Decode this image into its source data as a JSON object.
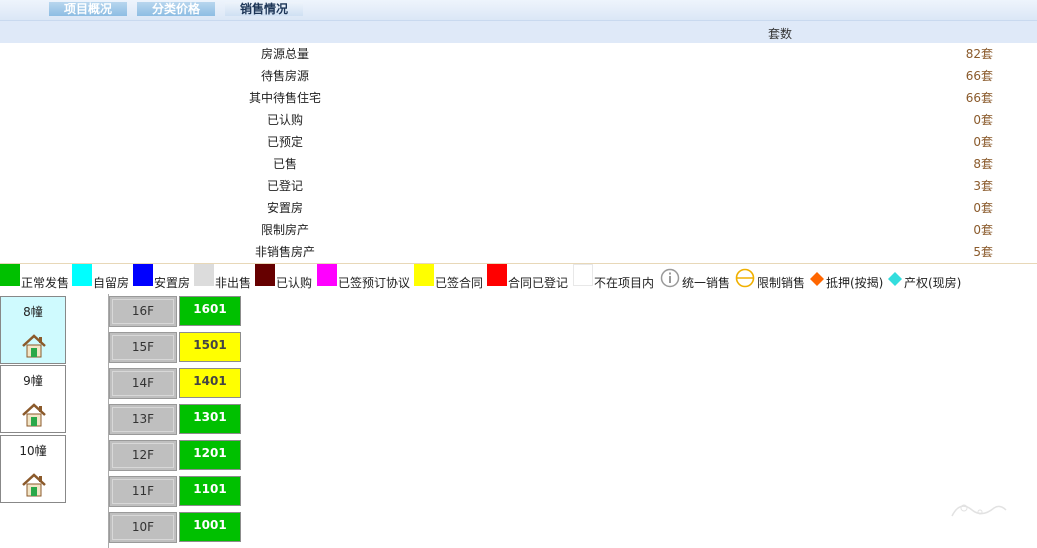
{
  "tabs": [
    {
      "label": "项目概况"
    },
    {
      "label": "分类价格"
    },
    {
      "label": "销售情况"
    }
  ],
  "stats": {
    "col_header": "套数",
    "rows": [
      {
        "label": "房源总量",
        "value": "82套"
      },
      {
        "label": "待售房源",
        "value": "66套"
      },
      {
        "label": "其中待售住宅",
        "value": "66套"
      },
      {
        "label": "已认购",
        "value": "0套"
      },
      {
        "label": "已预定",
        "value": "0套"
      },
      {
        "label": "已售",
        "value": "8套"
      },
      {
        "label": "已登记",
        "value": "3套"
      },
      {
        "label": "安置房",
        "value": "0套"
      },
      {
        "label": "限制房产",
        "value": "0套"
      },
      {
        "label": "非销售房产",
        "value": "5套"
      }
    ]
  },
  "legend": [
    {
      "label": "正常发售",
      "color": "#00c000",
      "icon": "swatch"
    },
    {
      "label": "自留房",
      "color": "#00ffff",
      "icon": "swatch"
    },
    {
      "label": "安置房",
      "color": "#0000ff",
      "icon": "swatch"
    },
    {
      "label": "非出售",
      "color": "#dcdcdc",
      "icon": "swatch"
    },
    {
      "label": "已认购",
      "color": "#660000",
      "icon": "swatch"
    },
    {
      "label": "已签预订协议",
      "color": "#ff00ff",
      "icon": "swatch"
    },
    {
      "label": "已签合同",
      "color": "#ffff00",
      "icon": "swatch"
    },
    {
      "label": "合同已登记",
      "color": "#ff0000",
      "icon": "swatch"
    },
    {
      "label": "不在项目内",
      "color": "#ffffff",
      "icon": "swatch"
    },
    {
      "label": "统一销售",
      "color": "#999999",
      "icon": "info-circle-icon"
    },
    {
      "label": "限制销售",
      "color": "#f0b000",
      "icon": "restrict-circle-icon"
    },
    {
      "label": "抵押(按揭)",
      "color": "#ff6600",
      "icon": "diamond-icon"
    },
    {
      "label": "产权(现房)",
      "color": "#33dddd",
      "icon": "diamond-icon"
    }
  ],
  "buildings": [
    {
      "name": "8幢",
      "selected": true
    },
    {
      "name": "9幢",
      "selected": false
    },
    {
      "name": "10幢",
      "selected": false
    }
  ],
  "floors": [
    {
      "floor": "16F",
      "unit": "1601",
      "status": "green"
    },
    {
      "floor": "15F",
      "unit": "1501",
      "status": "yellow"
    },
    {
      "floor": "14F",
      "unit": "1401",
      "status": "yellow"
    },
    {
      "floor": "13F",
      "unit": "1301",
      "status": "green"
    },
    {
      "floor": "12F",
      "unit": "1201",
      "status": "green"
    },
    {
      "floor": "11F",
      "unit": "1101",
      "status": "green"
    },
    {
      "floor": "10F",
      "unit": "1001",
      "status": "green"
    }
  ]
}
